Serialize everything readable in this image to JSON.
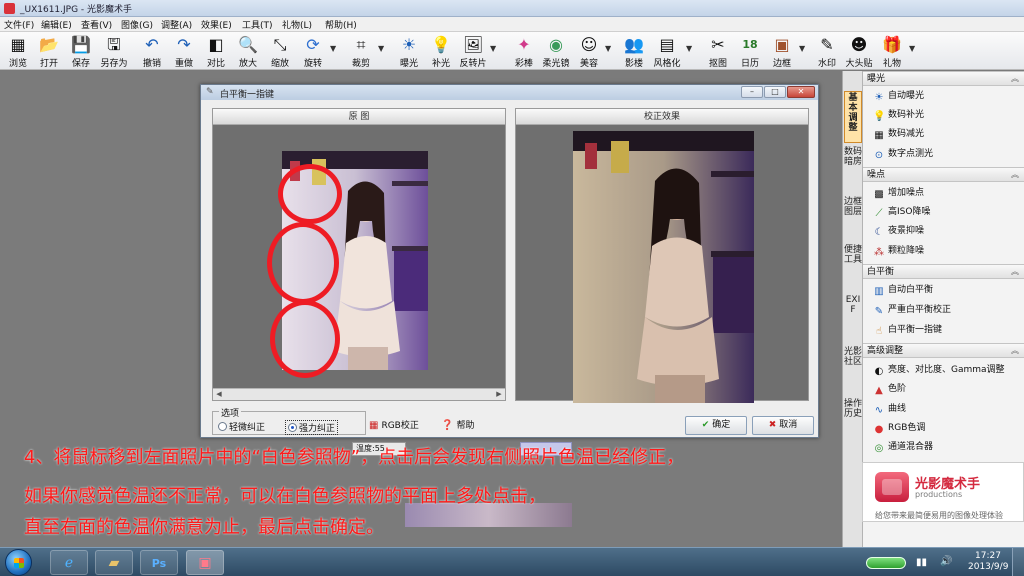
{
  "window": {
    "title": "_UX1611.JPG - 光影魔术手"
  },
  "menu": [
    "文件(F)",
    "编辑(E)",
    "查看(V)",
    "图像(G)",
    "调整(A)",
    "效果(E)",
    "工具(T)",
    "礼物(L)",
    "帮助(H)"
  ],
  "toolbar": [
    {
      "label": "浏览",
      "icon": "browse-icon",
      "glyph": "▦"
    },
    {
      "label": "打开",
      "icon": "open-folder-icon",
      "glyph": "📂"
    },
    {
      "label": "保存",
      "icon": "save-icon",
      "glyph": "💾"
    },
    {
      "label": "另存为",
      "icon": "save-as-icon",
      "glyph": "🖫"
    },
    {
      "label": "撤销",
      "icon": "undo-icon",
      "glyph": "↶"
    },
    {
      "label": "重做",
      "icon": "redo-icon",
      "glyph": "↷"
    },
    {
      "label": "对比",
      "icon": "compare-icon",
      "glyph": "◧"
    },
    {
      "label": "放大",
      "icon": "zoom-in-icon",
      "glyph": "🔍"
    },
    {
      "label": "缩放",
      "icon": "resize-icon",
      "glyph": "⤡"
    },
    {
      "label": "旋转",
      "icon": "rotate-icon",
      "glyph": "⟳"
    },
    {
      "label": "裁剪",
      "icon": "crop-icon",
      "glyph": "⌗"
    },
    {
      "label": "曝光",
      "icon": "exposure-icon",
      "glyph": "☀"
    },
    {
      "label": "补光",
      "icon": "fill-light-icon",
      "glyph": "💡"
    },
    {
      "label": "反转片",
      "icon": "slide-film-icon",
      "glyph": "🖼"
    },
    {
      "label": "彩棒",
      "icon": "color-wand-icon",
      "glyph": "✦"
    },
    {
      "label": "柔光镜",
      "icon": "soft-lens-icon",
      "glyph": "◉"
    },
    {
      "label": "美容",
      "icon": "beauty-icon",
      "glyph": "☺"
    },
    {
      "label": "影楼",
      "icon": "studio-icon",
      "glyph": "👥"
    },
    {
      "label": "风格化",
      "icon": "stylize-icon",
      "glyph": "▤"
    },
    {
      "label": "抠图",
      "icon": "cutout-icon",
      "glyph": "✂"
    },
    {
      "label": "日历",
      "icon": "calendar-icon",
      "glyph": "18"
    },
    {
      "label": "边框",
      "icon": "frame-icon",
      "glyph": "▣"
    },
    {
      "label": "水印",
      "icon": "watermark-icon",
      "glyph": "✎"
    },
    {
      "label": "大头贴",
      "icon": "sticker-icon",
      "glyph": "☻"
    },
    {
      "label": "礼物",
      "icon": "gift-icon",
      "glyph": "🎁"
    }
  ],
  "dialog": {
    "title": "白平衡一指键",
    "panels": {
      "original": "原 图",
      "corrected": "校正效果"
    },
    "options": {
      "legend": "选项",
      "light": "轻微纠正",
      "strong": "强力纠正"
    },
    "rgb_button": "RGB校正",
    "help_button": "帮助",
    "ok_button": "确定",
    "cancel_button": "取消"
  },
  "sidebar": {
    "tabs": [
      "基本调整",
      "数码暗房",
      "边框图层",
      "便捷工具",
      "EXIF",
      "光影社区",
      "操作历史"
    ],
    "categories": [
      {
        "title": "曝光",
        "items": [
          {
            "label": "自动曝光",
            "icon": "auto-exposure-icon",
            "glyph": "☀"
          },
          {
            "label": "数码补光",
            "icon": "digital-fill-icon",
            "glyph": "💡"
          },
          {
            "label": "数码减光",
            "icon": "digital-dim-icon",
            "glyph": "▦"
          },
          {
            "label": "数字点测光",
            "icon": "spot-meter-icon",
            "glyph": "⊙"
          }
        ]
      },
      {
        "title": "噪点",
        "items": [
          {
            "label": "增加噪点",
            "icon": "add-noise-icon",
            "glyph": "▩"
          },
          {
            "label": "高ISO降噪",
            "icon": "iso-denoise-icon",
            "glyph": "⟋"
          },
          {
            "label": "夜景抑噪",
            "icon": "night-denoise-icon",
            "glyph": "☾"
          },
          {
            "label": "颗粒降噪",
            "icon": "grain-denoise-icon",
            "glyph": "⁂"
          }
        ]
      },
      {
        "title": "白平衡",
        "items": [
          {
            "label": "自动白平衡",
            "icon": "auto-wb-icon",
            "glyph": "▥"
          },
          {
            "label": "严重白平衡校正",
            "icon": "strong-wb-icon",
            "glyph": "✎"
          },
          {
            "label": "白平衡一指键",
            "icon": "wb-one-touch-icon",
            "glyph": "☝"
          }
        ]
      },
      {
        "title": "高级调整",
        "items": [
          {
            "label": "亮度、对比度、Gamma调整",
            "icon": "brightness-icon",
            "glyph": "◐"
          },
          {
            "label": "色阶",
            "icon": "levels-icon",
            "glyph": "▲"
          },
          {
            "label": "曲线",
            "icon": "curves-icon",
            "glyph": "∿"
          },
          {
            "label": "RGB色调",
            "icon": "rgb-tone-icon",
            "glyph": "●"
          },
          {
            "label": "通道混合器",
            "icon": "channel-mixer-icon",
            "glyph": "◎"
          }
        ]
      }
    ]
  },
  "promo": {
    "name": "光影魔术手",
    "sub": "productions",
    "slogan": "给您带来最简便易用的图像处理体验"
  },
  "instructions": [
    "4、将鼠标移到左面照片中的“白色参照物”，点击后会发现右侧照片色温已经修正，",
    "如果你感觉色温还不正常，可以在白色参照物的平面上多处点击，",
    "直至右面的色温你满意为止，最后点击确定。"
  ],
  "status": {
    "partial": "温度:55"
  },
  "taskbar": {
    "time": "17:27",
    "date": "2013/9/9"
  }
}
